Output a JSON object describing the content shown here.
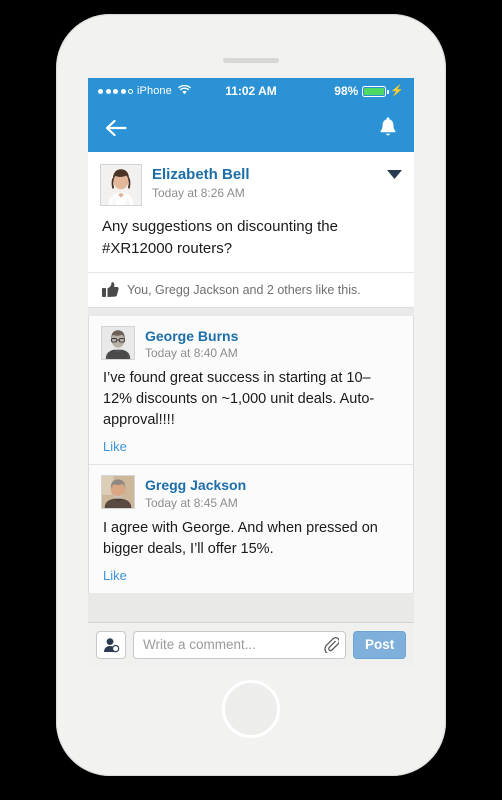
{
  "status_bar": {
    "carrier": "iPhone",
    "signal_dots_filled": 4,
    "signal_dots_total": 5,
    "wifi_icon": "wifi-icon",
    "time": "11:02 AM",
    "battery_percent": "98%",
    "battery_level": 98,
    "charging": true
  },
  "nav_bar": {
    "back_icon": "back-arrow-icon",
    "bell_icon": "bell-icon",
    "background_color": "#2b93d5"
  },
  "post": {
    "author": "Elizabeth Bell",
    "timestamp": "Today at 8:26 AM",
    "menu_icon": "chevron-down-icon",
    "body": "Any suggestions on discounting the #XR12000 routers?",
    "likes": {
      "icon": "thumbs-up-icon",
      "text": "You, Gregg Jackson and 2 others like this."
    }
  },
  "comments": [
    {
      "author": "George Burns",
      "timestamp": "Today at 8:40 AM",
      "body": "I’ve found great success in starting at 10–12% discounts on ~1,000 unit deals. Auto-approval!!!!",
      "like_label": "Like"
    },
    {
      "author": "Gregg Jackson",
      "timestamp": "Today at 8:45 AM",
      "body": "I agree with George. And when pressed on bigger deals, I’ll offer 15%.",
      "like_label": "Like"
    }
  ],
  "composer": {
    "mention_icon": "add-person-icon",
    "placeholder": "Write a comment...",
    "value": "",
    "attach_icon": "paperclip-icon",
    "post_label": "Post"
  },
  "colors": {
    "accent_blue": "#2b93d5",
    "link_blue": "#1c6ea8",
    "post_button": "#7fb0db",
    "battery_green": "#4cd964"
  }
}
